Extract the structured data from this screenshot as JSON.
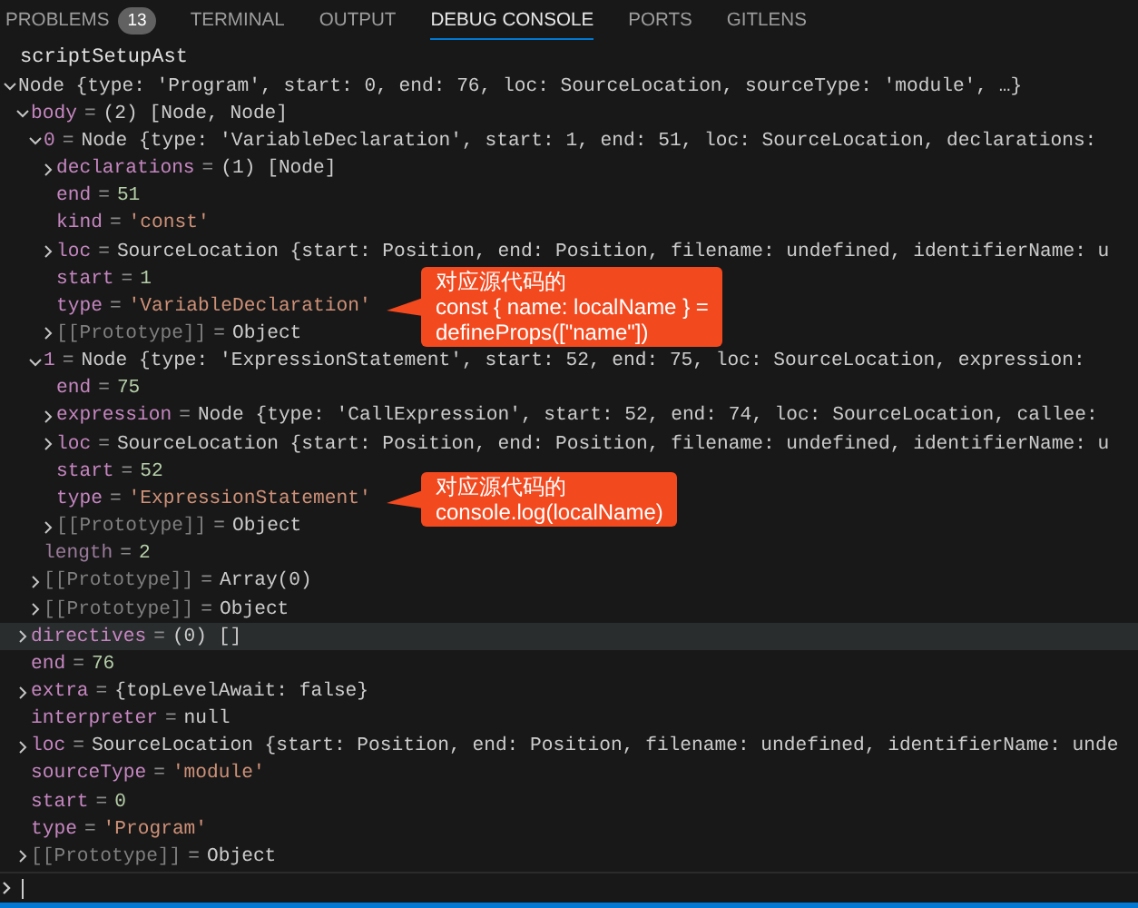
{
  "tabs": [
    {
      "label": "PROBLEMS",
      "badge": "13",
      "selected": false
    },
    {
      "label": "TERMINAL",
      "selected": false
    },
    {
      "label": "OUTPUT",
      "selected": false
    },
    {
      "label": "DEBUG CONSOLE",
      "selected": true
    },
    {
      "label": "PORTS",
      "selected": false
    },
    {
      "label": "GITLENS",
      "selected": false
    }
  ],
  "console": {
    "label": "scriptSetupAst",
    "tree": [
      {
        "value": "Node {type: 'Program', start: 0, end: 76, loc: SourceLocation, sourceType: 'module', …}",
        "kind": "plain",
        "expanded": true,
        "selected": false,
        "children": [
          {
            "name": "body",
            "kind": "plain",
            "separator": "=",
            "value": "(2) [Node, Node]",
            "expanded": true,
            "selected": false,
            "children": [
              {
                "name": "0",
                "kind": "plain",
                "separator": "=",
                "value": "Node {type: 'VariableDeclaration', start: 1, end: 51, loc: SourceLocation, declarations:",
                "expanded": true,
                "selected": false,
                "children": [
                  {
                    "name": "declarations",
                    "kind": "plain",
                    "separator": "=",
                    "value": "(1) [Node]",
                    "expanded": false,
                    "selected": false
                  },
                  {
                    "name": "end",
                    "kind": "number",
                    "separator": "=",
                    "value": "51",
                    "selected": false
                  },
                  {
                    "name": "kind",
                    "kind": "string",
                    "separator": "=",
                    "value": "'const'",
                    "selected": false
                  },
                  {
                    "name": "loc",
                    "kind": "plain",
                    "separator": "=",
                    "value": "SourceLocation {start: Position, end: Position, filename: undefined, identifierName: u",
                    "expanded": false,
                    "selected": false
                  },
                  {
                    "name": "start",
                    "kind": "number",
                    "separator": "=",
                    "value": "1",
                    "selected": false
                  },
                  {
                    "name": "type",
                    "kind": "string",
                    "separator": "=",
                    "value": "'VariableDeclaration'",
                    "selected": false,
                    "note": "对应源代码的\nconst { name: localName } =\ndefineProps([\"name\"])"
                  },
                  {
                    "name": "[[Prototype]]",
                    "kind": "internal",
                    "separator": "=",
                    "value": "Object",
                    "expanded": false,
                    "selected": false
                  }
                ]
              },
              {
                "name": "1",
                "kind": "plain",
                "separator": "=",
                "value": "Node {type: 'ExpressionStatement', start: 52, end: 75, loc: SourceLocation, expression:",
                "expanded": true,
                "selected": false,
                "children": [
                  {
                    "name": "end",
                    "kind": "number",
                    "separator": "=",
                    "value": "75",
                    "selected": false
                  },
                  {
                    "name": "expression",
                    "kind": "plain",
                    "separator": "=",
                    "value": "Node {type: 'CallExpression', start: 52, end: 74, loc: SourceLocation, callee:",
                    "expanded": false,
                    "selected": false
                  },
                  {
                    "name": "loc",
                    "kind": "plain",
                    "separator": "=",
                    "value": "SourceLocation {start: Position, end: Position, filename: undefined, identifierName: u",
                    "expanded": false,
                    "selected": false
                  },
                  {
                    "name": "start",
                    "kind": "number",
                    "separator": "=",
                    "value": "52",
                    "selected": false
                  },
                  {
                    "name": "type",
                    "kind": "string",
                    "separator": "=",
                    "value": "'ExpressionStatement'",
                    "selected": false,
                    "note": "对应源代码的\nconsole.log(localName)"
                  },
                  {
                    "name": "[[Prototype]]",
                    "kind": "internal",
                    "separator": "=",
                    "value": "Object",
                    "expanded": false,
                    "selected": false
                  }
                ]
              },
              {
                "name": "length",
                "kind": "hidden",
                "separator": "=",
                "value": "2",
                "selected": false
              },
              {
                "name": "[[Prototype]]",
                "kind": "internal",
                "separator": "=",
                "value": "Array(0)",
                "expanded": false,
                "selected": false
              },
              {
                "name": "[[Prototype]]",
                "kind": "internal",
                "separator": "=",
                "value": "Object",
                "expanded": false,
                "selected": false
              }
            ]
          },
          {
            "name": "directives",
            "kind": "plain",
            "separator": "=",
            "value": "(0) []",
            "expanded": false,
            "selected": true
          },
          {
            "name": "end",
            "kind": "number",
            "separator": "=",
            "value": "76",
            "selected": false
          },
          {
            "name": "extra",
            "kind": "plain",
            "separator": "=",
            "value": "{topLevelAwait: false}",
            "expanded": false,
            "selected": false
          },
          {
            "name": "interpreter",
            "kind": "plain",
            "separator": "=",
            "value": "null",
            "selected": false
          },
          {
            "name": "loc",
            "kind": "plain",
            "separator": "=",
            "value": "SourceLocation {start: Position, end: Position, filename: undefined, identifierName: unde",
            "expanded": false,
            "selected": false
          },
          {
            "name": "sourceType",
            "kind": "string",
            "separator": "=",
            "value": "'module'",
            "selected": false
          },
          {
            "name": "start",
            "kind": "number",
            "separator": "=",
            "value": "0",
            "selected": false
          },
          {
            "name": "type",
            "kind": "string",
            "separator": "=",
            "value": "'Program'",
            "selected": false
          },
          {
            "name": "[[Prototype]]",
            "kind": "internal",
            "separator": "=",
            "value": "Object",
            "expanded": false,
            "selected": false
          }
        ]
      }
    ]
  }
}
